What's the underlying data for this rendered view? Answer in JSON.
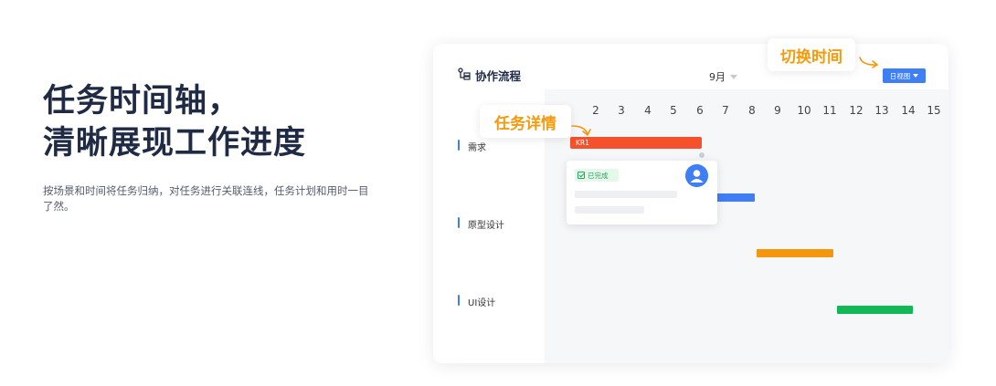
{
  "hero": {
    "title_line1": "任务时间轴，",
    "title_line2": "清晰展现工作进度",
    "description": "按场景和时间将任务归纳，对任务进行关联连线，任务计划和用时一目了然。"
  },
  "gantt": {
    "title": "协作流程",
    "month": "9月",
    "view_button": "日视图",
    "days": [
      "2",
      "3",
      "4",
      "5",
      "6",
      "7",
      "8",
      "9",
      "10",
      "11",
      "12",
      "13",
      "14",
      "15"
    ],
    "rows": [
      {
        "label": "需求"
      },
      {
        "label": "原型设计"
      },
      {
        "label": "UI设计"
      }
    ],
    "kr_label": "KR1",
    "detail": {
      "status": "已完成"
    },
    "colors": {
      "kr": "#f4512c",
      "blue": "#3f7ef5",
      "orange": "#f5960c",
      "green": "#12b856",
      "accent": "#f59a0c"
    }
  },
  "callouts": {
    "switch_view": "切换时间",
    "task_detail": "任务详情"
  }
}
